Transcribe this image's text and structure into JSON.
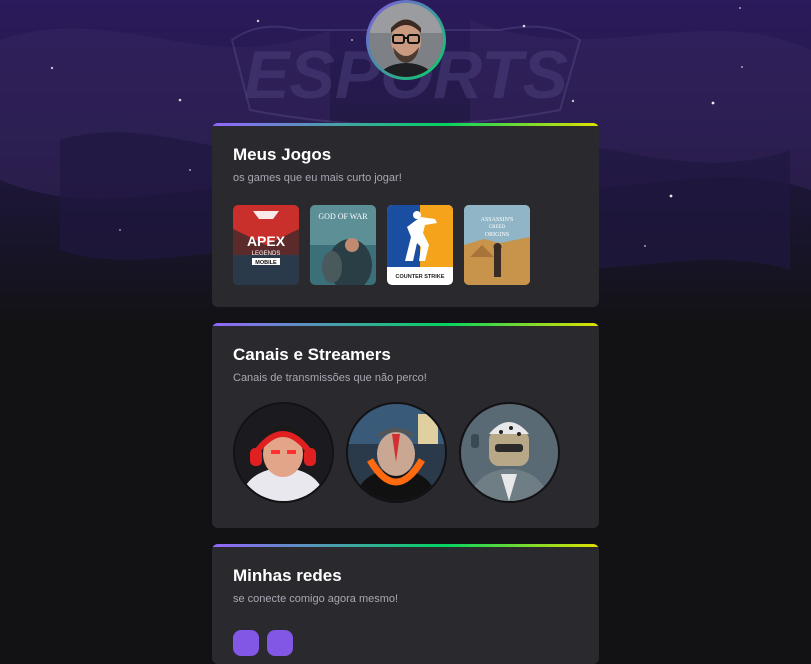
{
  "background": {
    "logo_text": "ESPORTS"
  },
  "profile": {
    "avatar_icon": "profile-photo"
  },
  "games_section": {
    "title": "Meus Jogos",
    "subtitle": "os games que eu mais curto jogar!",
    "games": [
      {
        "icon": "apex-legends-mobile-cover",
        "label_main": "APEX",
        "label_sub": "LEGENDS",
        "label_tag": "MOBILE"
      },
      {
        "icon": "god-of-war-cover",
        "label_main": "GOD OF WAR"
      },
      {
        "icon": "counter-strike-cover",
        "label_main": "COUNTER STRIKE"
      },
      {
        "icon": "assassins-creed-origins-cover",
        "label_main": "ASSASSIN'S",
        "label_sub": "CREED",
        "label_tag": "ORIGINS"
      }
    ]
  },
  "streamers_section": {
    "title": "Canais e Streamers",
    "subtitle": "Canais de transmissões que não perco!",
    "streamers": [
      {
        "icon": "streamer-avatar-1"
      },
      {
        "icon": "streamer-avatar-2"
      },
      {
        "icon": "streamer-avatar-3"
      }
    ]
  },
  "networks_section": {
    "title": "Minhas redes",
    "subtitle": "se conecte comigo agora mesmo!"
  },
  "colors": {
    "accent": "#8257e5",
    "card_bg": "#29292e",
    "page_bg": "#121214",
    "gradient_start": "#9466ff",
    "gradient_mid": "#04d361",
    "gradient_end": "#e1e100"
  }
}
